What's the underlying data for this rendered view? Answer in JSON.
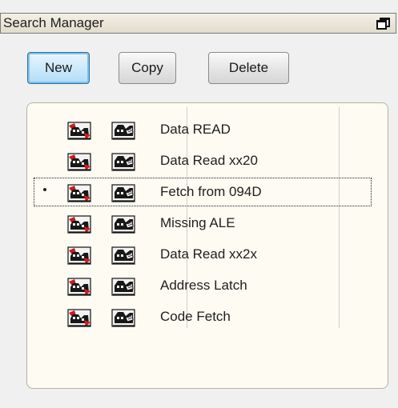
{
  "window": {
    "title": "Search Manager",
    "restore_icon": "restore-window-icon"
  },
  "toolbar": {
    "new_label": "New",
    "copy_label": "Copy",
    "delete_label": "Delete"
  },
  "list": {
    "selected_index": 2,
    "items": [
      {
        "label": "Data READ",
        "selected": false
      },
      {
        "label": "Data Read xx20",
        "selected": false
      },
      {
        "label": "Fetch from 094D",
        "selected": true
      },
      {
        "label": "Missing ALE",
        "selected": false
      },
      {
        "label": "Data Read xx2x",
        "selected": false
      },
      {
        "label": "Address Latch",
        "selected": false
      },
      {
        "label": "Code Fetch",
        "selected": false
      }
    ],
    "icons": {
      "first": "logic-analyzer-trace-icon",
      "second": "logic-analyzer-note-icon"
    }
  },
  "colors": {
    "panel_bg": "#fdfbf2",
    "default_button": "#cdeafc",
    "titlebar": "#e8e3d6"
  }
}
